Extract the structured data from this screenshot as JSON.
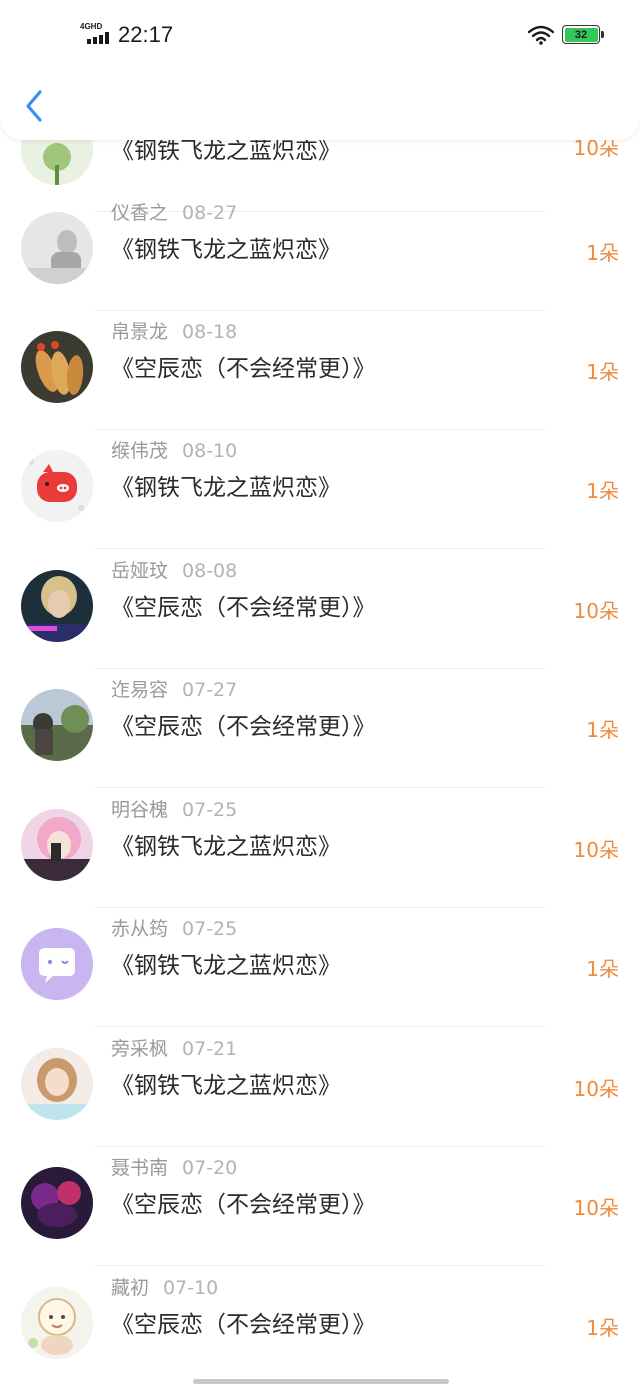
{
  "status_bar": {
    "time": "22:17",
    "network": "4GHD",
    "battery": "32"
  },
  "nav": {
    "back_icon": "chevron-left-icon"
  },
  "records": [
    {
      "name": "",
      "date": "",
      "title": "《钢铁飞龙之蓝炽恋》",
      "flowers": "10朵",
      "avatar": "flower-photo"
    },
    {
      "name": "仪香之",
      "date": "08-27",
      "title": "《钢铁飞龙之蓝炽恋》",
      "flowers": "1朵",
      "avatar": "grayscale-photo"
    },
    {
      "name": "帛景龙",
      "date": "08-18",
      "title": "《空辰恋（不会经常更）》",
      "flowers": "1朵",
      "avatar": "fried-shrimp-photo"
    },
    {
      "name": "缑伟茂",
      "date": "08-10",
      "title": "《钢铁飞龙之蓝炽恋》",
      "flowers": "1朵",
      "avatar": "red-pig-cartoon"
    },
    {
      "name": "岳娅玟",
      "date": "08-08",
      "title": "《空辰恋（不会经常更）》",
      "flowers": "10朵",
      "avatar": "blond-man-photo"
    },
    {
      "name": "迮易容",
      "date": "07-27",
      "title": "《空辰恋（不会经常更）》",
      "flowers": "1朵",
      "avatar": "scenery-photo"
    },
    {
      "name": "明谷槐",
      "date": "07-25",
      "title": "《钢铁飞龙之蓝炽恋》",
      "flowers": "10朵",
      "avatar": "pink-hair-anime"
    },
    {
      "name": "赤从筠",
      "date": "07-25",
      "title": "《钢铁飞龙之蓝炽恋》",
      "flowers": "1朵",
      "avatar": "purple-chat-icon"
    },
    {
      "name": "旁采枫",
      "date": "07-21",
      "title": "《钢铁飞龙之蓝炽恋》",
      "flowers": "10朵",
      "avatar": "girl-photo"
    },
    {
      "name": "聂书南",
      "date": "07-20",
      "title": "《空辰恋（不会经常更）》",
      "flowers": "10朵",
      "avatar": "dark-purple-art"
    },
    {
      "name": "藏初",
      "date": "07-10",
      "title": "《空辰恋（不会经常更）》",
      "flowers": "1朵",
      "avatar": "cartoon-sheep"
    }
  ]
}
